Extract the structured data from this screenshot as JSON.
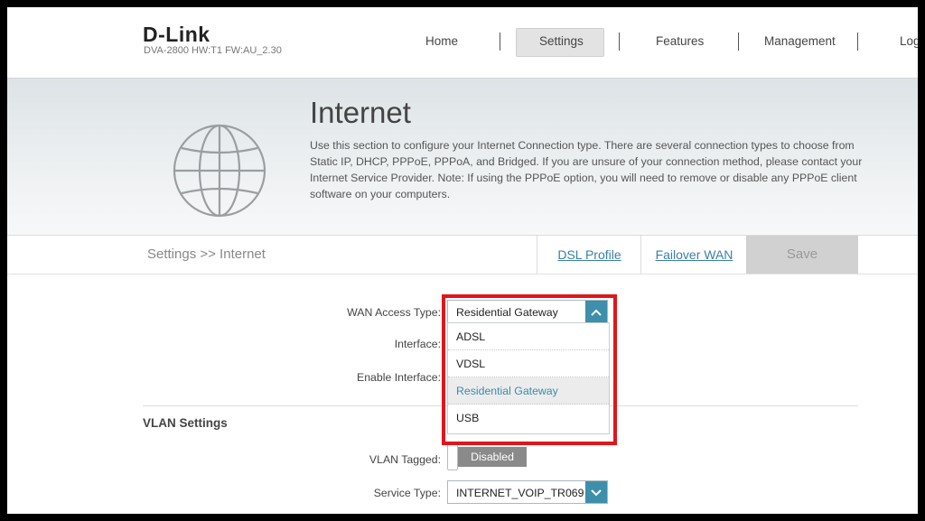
{
  "brand": {
    "logo": "D-Link",
    "model": "DVA-2800   HW:T1   FW:AU_2.30"
  },
  "nav": {
    "home": "Home",
    "settings": "Settings",
    "features": "Features",
    "management": "Management",
    "logout": "Log"
  },
  "banner": {
    "title": "Internet",
    "description": "Use this section to configure your Internet Connection type. There are several connection types to choose from Static IP, DHCP, PPPoE, PPPoA, and Bridged. If you are unsure of your connection method, please contact your Internet Service Provider. Note: If using the PPPoE option, you will need to remove or disable any PPPoE client software on your computers."
  },
  "breadcrumb": "Settings >> Internet",
  "actions": {
    "dsl_profile": "DSL Profile",
    "failover_wan": "Failover WAN",
    "save": "Save"
  },
  "form": {
    "wan_access_type_label": "WAN Access Type:",
    "wan_access_type_value": "Residential Gateway",
    "interface_label": "Interface:",
    "enable_interface_label": "Enable Interface:",
    "dropdown_options": [
      "ADSL",
      "VDSL",
      "Residential Gateway",
      "USB"
    ],
    "selected_option": "Residential Gateway"
  },
  "vlan": {
    "heading": "VLAN Settings",
    "tagged_label": "VLAN Tagged:",
    "tagged_value": "Disabled",
    "service_type_label": "Service Type:",
    "service_type_value": "INTERNET_VOIP_TR069"
  },
  "colors": {
    "accent": "#3d8fab",
    "highlight_border": "#e0161b",
    "link": "#3a7fa6"
  }
}
